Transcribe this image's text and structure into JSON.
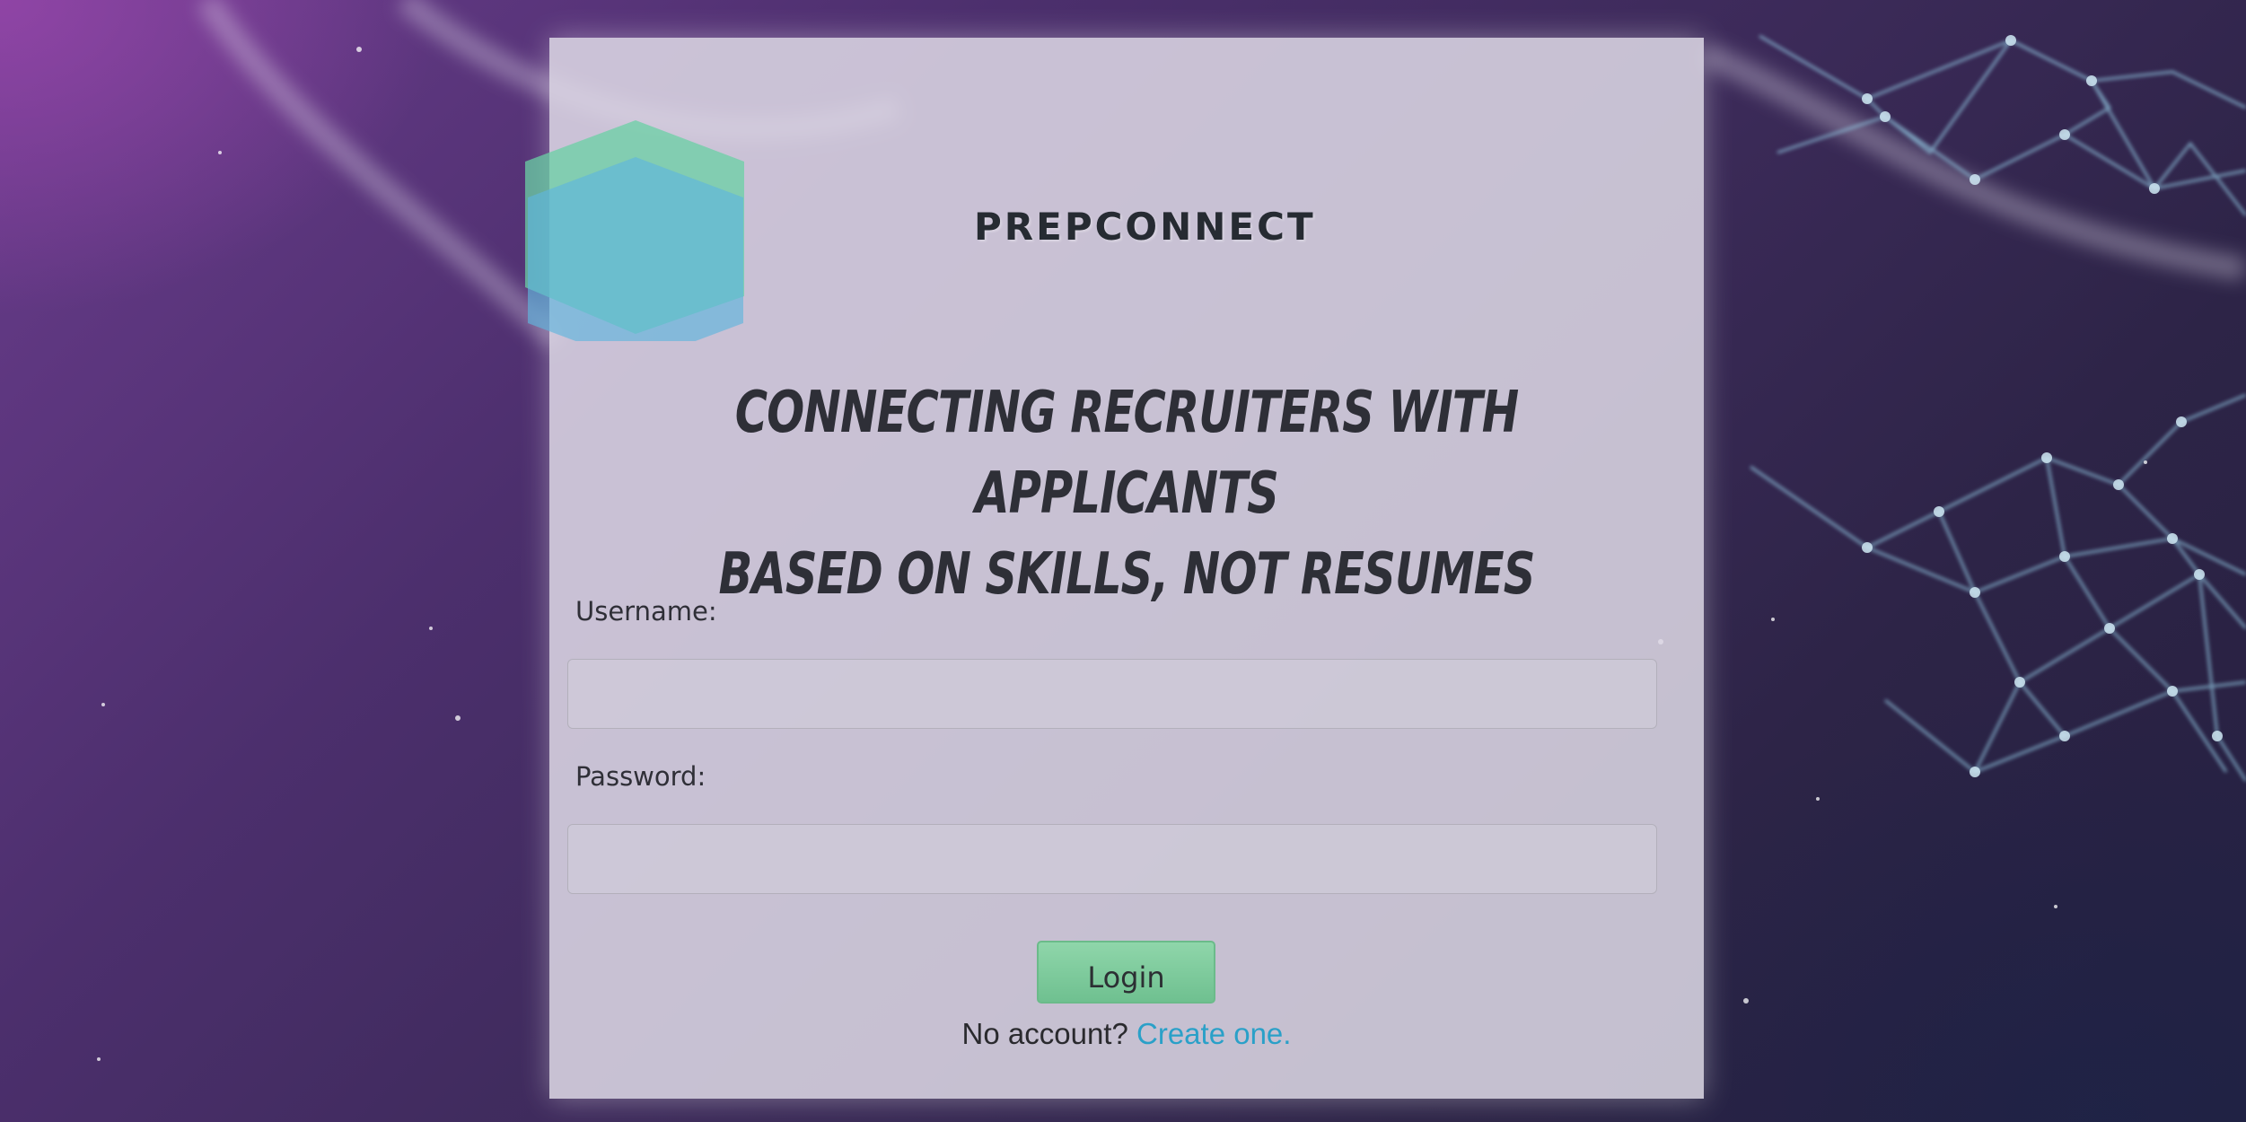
{
  "brand": {
    "name": "PREPCONNECT",
    "colors": {
      "hex_green": "#6fcf9e",
      "hex_teal": "#5bbfd0",
      "hex_blue": "#69b6e2"
    }
  },
  "tagline": {
    "line1": "Connecting recruiters with applicants",
    "line2": "based on skills, not resumes"
  },
  "form": {
    "username_label": "Username:",
    "password_label": "Password:",
    "username_value": "",
    "password_value": "",
    "login_label": "Login",
    "no_account_text": "No account?",
    "create_link_text": "Create one."
  },
  "colors": {
    "accent_link": "#2aa0c8",
    "login_button": "#7dcb9c"
  }
}
